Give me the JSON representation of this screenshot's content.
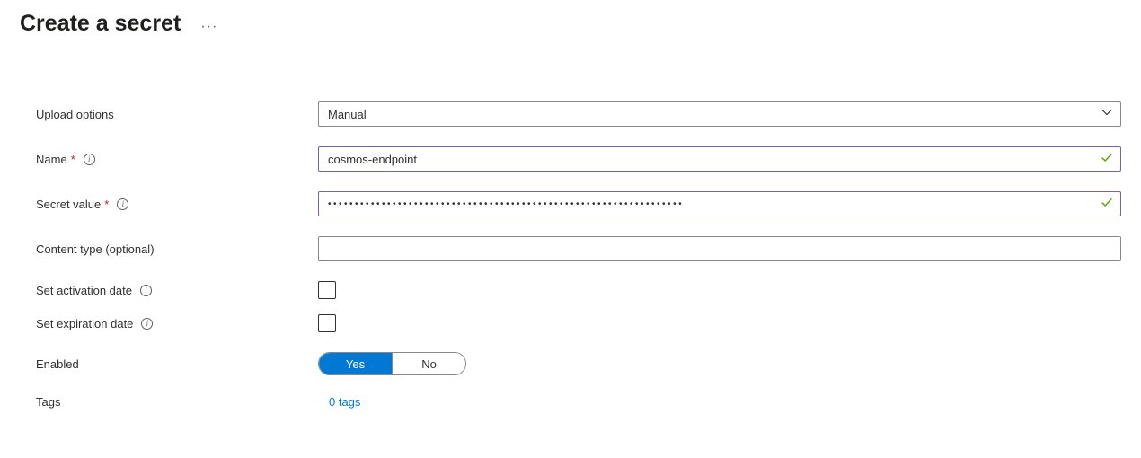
{
  "header": {
    "title": "Create a secret",
    "more": "···"
  },
  "form": {
    "upload_options": {
      "label": "Upload options",
      "value": "Manual"
    },
    "name": {
      "label": "Name",
      "value": "cosmos-endpoint"
    },
    "secret_value": {
      "label": "Secret value",
      "value": "••••••••••••••••••••••••••••••••••••••••••••••••••••••••••••••••••"
    },
    "content_type": {
      "label": "Content type (optional)",
      "value": ""
    },
    "activation": {
      "label": "Set activation date"
    },
    "expiration": {
      "label": "Set expiration date"
    },
    "enabled": {
      "label": "Enabled",
      "yes": "Yes",
      "no": "No"
    },
    "tags": {
      "label": "Tags",
      "link": "0 tags"
    },
    "info_glyph": "i"
  }
}
